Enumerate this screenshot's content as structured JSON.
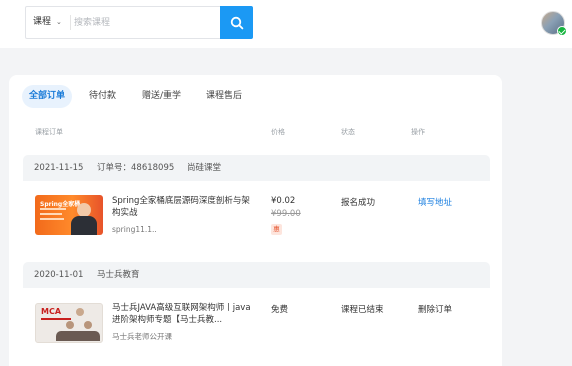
{
  "header": {
    "category_label": "课程",
    "search_placeholder": "搜索课程"
  },
  "tabs": [
    {
      "label": "全部订单"
    },
    {
      "label": "待付款"
    },
    {
      "label": "赠送/重学"
    },
    {
      "label": "课程售后"
    }
  ],
  "columns": {
    "course": "课程订单",
    "price": "价格",
    "status": "状态",
    "action": "操作"
  },
  "orders": [
    {
      "date": "2021-11-15",
      "order_no": "订单号：48618095",
      "shop": "尚硅课堂",
      "thumb_title": "Spring全家桶",
      "title": "Spring全家桶底层源码深度剖析与架构实战",
      "subtitle": "spring11.1..",
      "price": "¥0.02",
      "original_price": "¥99.00",
      "badge": "惠",
      "status": "报名成功",
      "action": "填写地址"
    },
    {
      "date": "2020-11-01",
      "shop": "马士兵教育",
      "thumb_title": "MCA",
      "title": "马士兵JAVA高级互联网架构师丨java进阶架构师专题【马士兵教...",
      "subtitle": "马士兵老师公开课",
      "price": "免费",
      "status": "课程已结束",
      "action": "删除订单"
    }
  ]
}
